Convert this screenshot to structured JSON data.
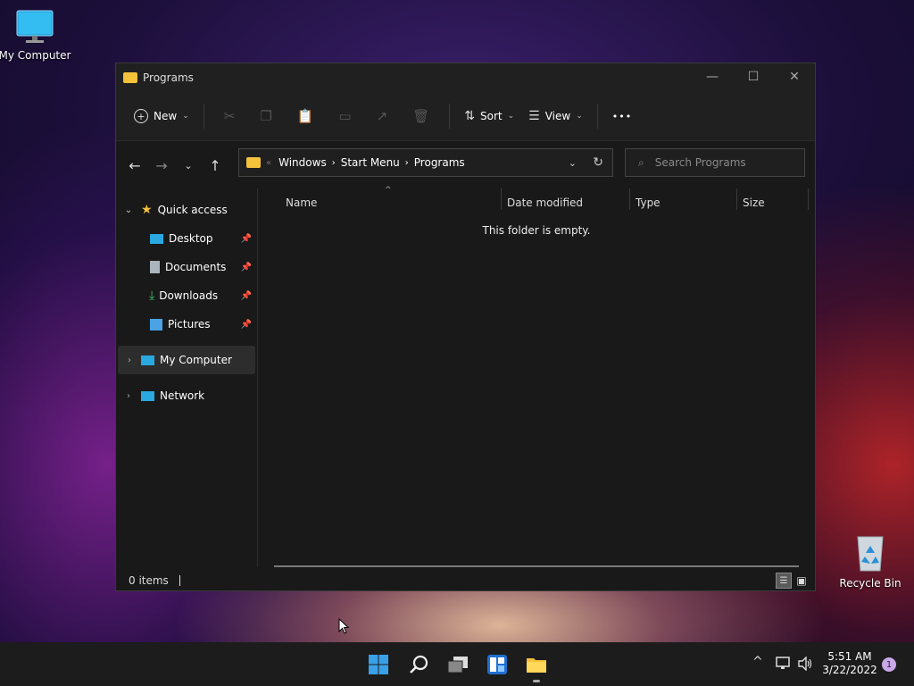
{
  "desktop": {
    "my_computer_label": "My Computer",
    "recycle_bin_label": "Recycle Bin"
  },
  "window": {
    "title": "Programs",
    "controls": {
      "minimize": "—",
      "maximize": "☐",
      "close": "✕"
    }
  },
  "command_bar": {
    "new_label": "New",
    "sort_label": "Sort",
    "view_label": "View",
    "more_label": "•••"
  },
  "address_bar": {
    "crumbs": [
      "Windows",
      "Start Menu",
      "Programs"
    ],
    "overflow": "«",
    "search_placeholder": "Search Programs"
  },
  "sidebar": {
    "quick_access": "Quick access",
    "items": [
      {
        "label": "Desktop",
        "icon": "desktop-icon"
      },
      {
        "label": "Documents",
        "icon": "documents-icon"
      },
      {
        "label": "Downloads",
        "icon": "download-icon"
      },
      {
        "label": "Pictures",
        "icon": "pictures-icon"
      }
    ],
    "my_computer": "My Computer",
    "network": "Network"
  },
  "columns": [
    "Name",
    "Date modified",
    "Type",
    "Size"
  ],
  "empty_message": "This folder is empty.",
  "status": {
    "items": "0 items"
  },
  "clock": {
    "time": "5:51 AM",
    "date": "3/22/2022",
    "notifications": "1"
  },
  "colors": {
    "accent": "#0078d4",
    "folder": "#f3c13a",
    "window_bg": "#191919"
  }
}
